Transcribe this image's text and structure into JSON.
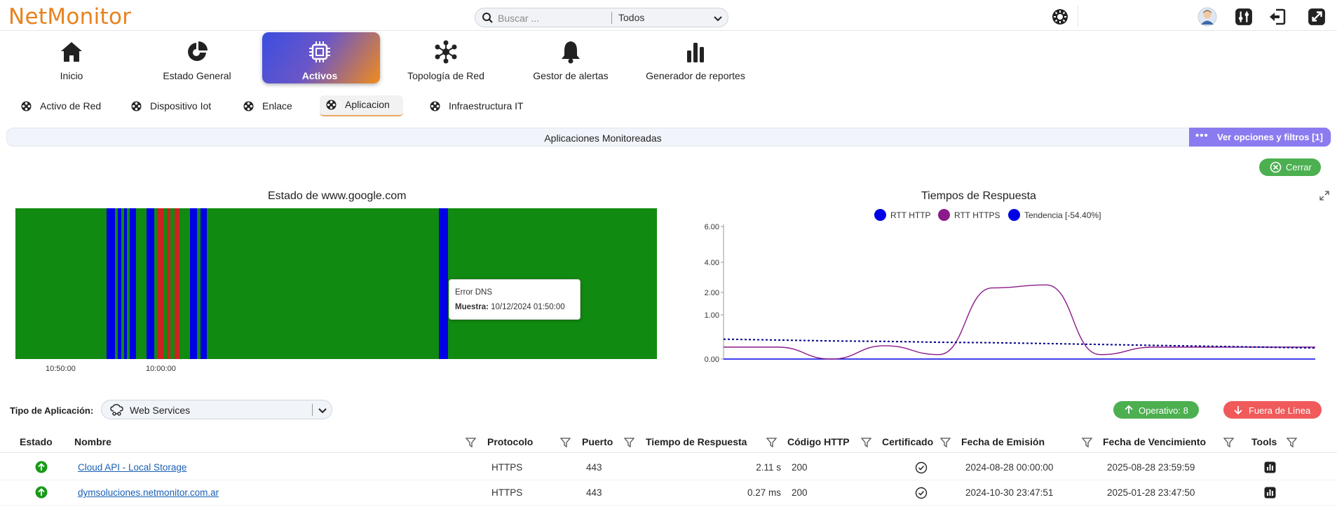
{
  "app": {
    "logo": "NetMonitor"
  },
  "search": {
    "placeholder": "Buscar ...",
    "scope": "Todos"
  },
  "topbar_icons": [
    "settings-icon",
    "avatar",
    "sliders-icon",
    "logout-icon",
    "external-link-icon"
  ],
  "nav": {
    "items": [
      {
        "label": "Inicio",
        "icon": "home-icon"
      },
      {
        "label": "Estado General",
        "icon": "pie-icon"
      },
      {
        "label": "Activos",
        "icon": "chip-icon",
        "active": true
      },
      {
        "label": "Topología de Red",
        "icon": "network-icon"
      },
      {
        "label": "Gestor de alertas",
        "icon": "bell-icon"
      },
      {
        "label": "Generador de reportes",
        "icon": "bar-chart-icon"
      }
    ]
  },
  "subtabs": [
    {
      "label": "Activo de Red"
    },
    {
      "label": "Dispositivo Iot"
    },
    {
      "label": "Enlace"
    },
    {
      "label": "Aplicacion",
      "active": true
    },
    {
      "label": "Infraestructura IT"
    }
  ],
  "section": {
    "title": "Aplicaciones Monitoreadas",
    "options_label": "Ver opciones y filtros [1]",
    "close_label": "Cerrar"
  },
  "colors": {
    "accent": "#8b7bf0",
    "ok": "#118a11",
    "dns_error": "#0000e6",
    "down": "#cc2222",
    "rtt_https": "#8b1a8b",
    "brand": "#e8821e"
  },
  "status_chart": {
    "title": "Estado de www.google.com",
    "x_ticks": [
      "10:50:00",
      "10:00:00"
    ],
    "tooltip": {
      "line1": "Error DNS",
      "line2_label": "Muestra:",
      "line2_value": "10/12/2024 01:50:00"
    }
  },
  "chart_data": {
    "type": "line",
    "title": "Tiempos de Respuesta",
    "y_ticks": [
      "6.00",
      "4.00",
      "2.00",
      "1.00",
      "0.00"
    ],
    "series": [
      {
        "name": "RTT HTTP",
        "color": "#0000e6",
        "values": [
          0,
          0,
          0,
          0,
          0,
          0,
          0,
          0,
          0,
          0,
          0,
          0
        ]
      },
      {
        "name": "RTT HTTPS",
        "color": "#8b1a8b",
        "values": [
          0.27,
          0.27,
          0.0,
          0.3,
          0.1,
          2.3,
          2.5,
          0.1,
          0.27,
          0.27,
          0.27,
          0.27
        ]
      },
      {
        "name": "Tendencia [-54.40%]",
        "color": "#00008b",
        "values": [
          0.45,
          0.43,
          0.41,
          0.4,
          0.38,
          0.37,
          0.35,
          0.33,
          0.31,
          0.29,
          0.27,
          0.25
        ]
      }
    ]
  },
  "filters": {
    "tipo_label": "Tipo de Aplicación:",
    "tipo_value": "Web Services",
    "operativo": "Operativo: 8",
    "fuera": "Fuera de Línea"
  },
  "table": {
    "headers": [
      "Estado",
      "Nombre",
      "Protocolo",
      "Puerto",
      "Tiempo de Respuesta",
      "Código HTTP",
      "Certificado",
      "Fecha de Emisión",
      "Fecha de Vencimiento",
      "Tools"
    ],
    "rows": [
      {
        "nombre": "Cloud API - Local Storage",
        "protocolo": "HTTPS",
        "puerto": "443",
        "tiempo": "2.11 s",
        "codigo": "200",
        "emision": "2024-08-28 00:00:00",
        "vencimiento": "2025-08-28 23:59:59"
      },
      {
        "nombre": "dymsoluciones.netmonitor.com.ar",
        "protocolo": "HTTPS",
        "puerto": "443",
        "tiempo": "0.27 ms",
        "codigo": "200",
        "emision": "2024-10-30 23:47:51",
        "vencimiento": "2025-01-28 23:47:50"
      }
    ]
  }
}
